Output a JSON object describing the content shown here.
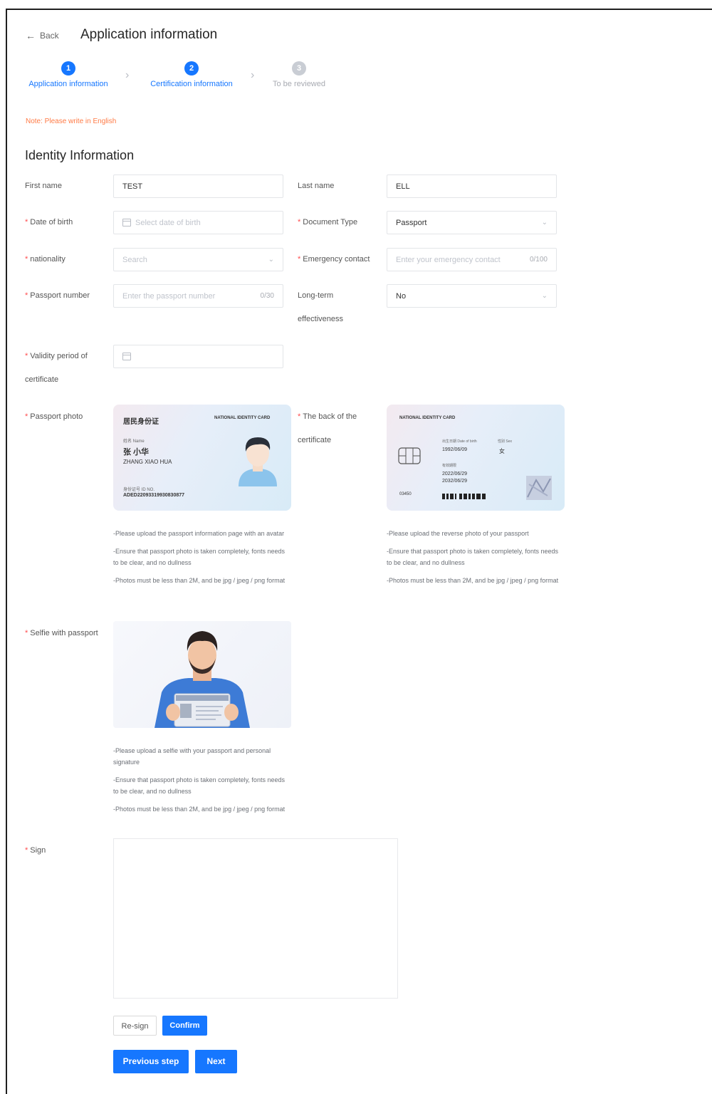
{
  "header": {
    "back_label": "Back",
    "title": "Application information"
  },
  "steps": [
    {
      "number": "1",
      "label": "Application information",
      "state": "active"
    },
    {
      "number": "2",
      "label": "Certification information",
      "state": "active"
    },
    {
      "number": "3",
      "label": "To be reviewed",
      "state": "pending"
    }
  ],
  "note": "Note: Please write in English",
  "section_title": "Identity Information",
  "fields": {
    "first_name": {
      "label": "First name",
      "value": "TEST"
    },
    "last_name": {
      "label": "Last name",
      "value": "ELL"
    },
    "dob": {
      "label": "Date of birth",
      "placeholder": "Select date of birth"
    },
    "doc_type": {
      "label": "Document Type",
      "value": "Passport"
    },
    "nationality": {
      "label": "nationality",
      "placeholder": "Search"
    },
    "emergency": {
      "label": "Emergency contact",
      "placeholder": "Enter your emergency contact",
      "count": "0/100"
    },
    "passport_number": {
      "label": "Passport number",
      "placeholder": "Enter the passport number",
      "count": "0/30"
    },
    "long_term": {
      "label_line1": "Long-term",
      "label_line2": "effectiveness",
      "value": "No"
    },
    "validity": {
      "label_line1": "Validity period of",
      "label_line2": "certificate"
    }
  },
  "passport_photo": {
    "label": "Passport photo",
    "card": {
      "title_cn": "居民身份证",
      "title_en": "NATIONAL IDENTITY CARD",
      "name_label": "姓名 Name",
      "name_cn": "张 小华",
      "name_en": "ZHANG XIAO HUA",
      "id_label": "身份证号 ID NO.",
      "id_number": "ADED22093319930830877"
    },
    "help": [
      "-Please upload the passport information page with an avatar",
      "-Ensure that passport photo is taken completely, fonts needs to be clear, and no dullness",
      "-Photos must be less than 2M, and be jpg / jpeg / png format"
    ]
  },
  "back_certificate": {
    "label_line1": "The back of the",
    "label_line2": "certificate",
    "card": {
      "title": "NATIONAL IDENTITY CARD",
      "dob_label": "出生日期 Date of birth",
      "dob": "1992/06/09",
      "sex_label": "性别 Sex",
      "sex": "女",
      "validity_label": "有效期限",
      "valid_from": "2022/06/29",
      "valid_to": "2032/06/29",
      "serial": "03450"
    },
    "help": [
      "-Please upload the reverse photo of your passport",
      "-Ensure that passport photo is taken completely, fonts needs to be clear, and no dullness",
      "-Photos must be less than 2M, and be jpg / jpeg / png format"
    ]
  },
  "selfie": {
    "label": "Selfie with passport",
    "help": [
      "-Please upload a selfie with your passport and personal signature",
      "-Ensure that passport photo is taken completely, fonts needs to be clear, and no dullness",
      "-Photos must be less than 2M, and be jpg / jpeg / png format"
    ]
  },
  "sign": {
    "label": "Sign",
    "resign_label": "Re-sign",
    "confirm_label": "Confirm"
  },
  "footer": {
    "previous_label": "Previous step",
    "next_label": "Next"
  },
  "colors": {
    "primary": "#1677ff",
    "required": "#ff4d4f",
    "note": "#ff7a45"
  }
}
